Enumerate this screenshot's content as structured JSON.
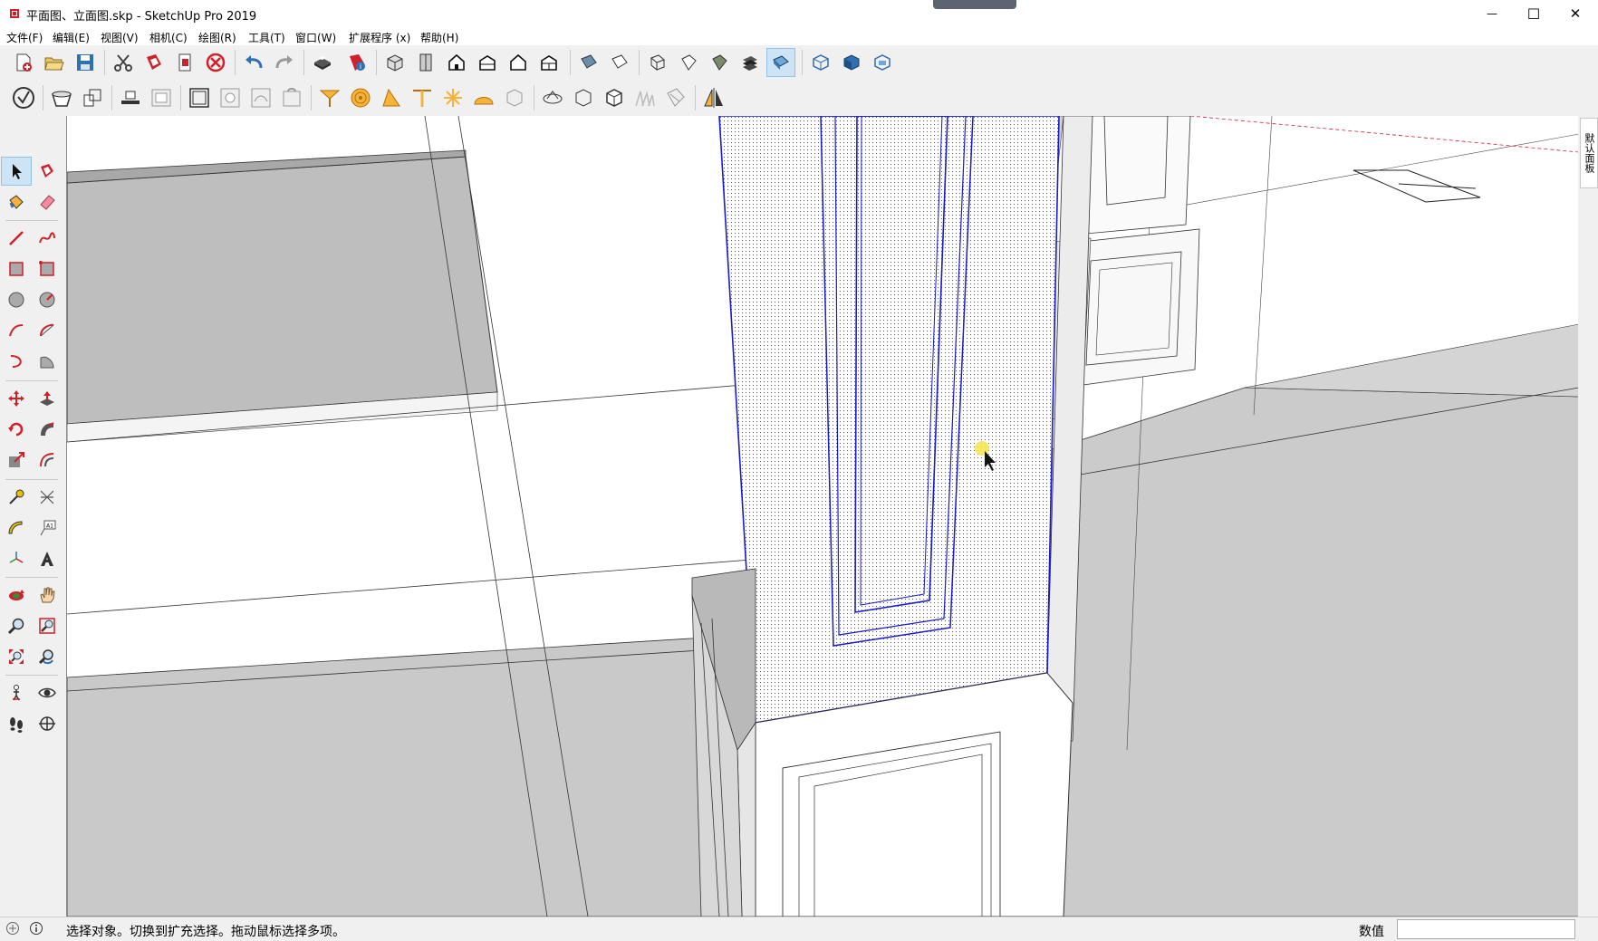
{
  "window": {
    "title": "平面图、立面图.skp - SketchUp Pro 2019",
    "minimize_glyph": "—",
    "maximize_glyph": "☐",
    "close_glyph": "✕"
  },
  "menu": [
    "文件(F)",
    "编辑(E)",
    "视图(V)",
    "相机(C)",
    "绘图(R)",
    "工具(T)",
    "窗口(W)",
    "扩展程序 (x)",
    "帮助(H)"
  ],
  "toolbar1_icons": [
    "new-file-icon",
    "open-folder-icon",
    "save-icon",
    "cut-icon",
    "paste-icon",
    "copy-icon",
    "erase-circle-icon",
    "undo-icon",
    "redo-icon",
    "print-icon",
    "model-info-icon",
    "iso-view-icon",
    "top-view-icon",
    "front-view-icon",
    "right-view-icon",
    "back-view-icon",
    "left-view-icon",
    "xray-icon",
    "back-edges-icon",
    "wireframe-icon",
    "hidden-line-icon",
    "shaded-icon",
    "shaded-textures-icon",
    "monochrome-icon",
    "section-planes-icon",
    "display-sections-icon",
    "section-cuts-icon"
  ],
  "toolbar2_icons": [
    "check-solid-icon",
    "outer-shell-icon",
    "intersect-icon",
    "subtract-icon",
    "union-icon",
    "trim-icon",
    "split-icon",
    "sandbox-from-contours-icon",
    "sandbox-from-scratch-icon",
    "smoove-icon",
    "stamp-icon",
    "drape-icon",
    "add-detail-icon",
    "flip-edge-icon",
    "position-camera-icon",
    "dimension-icon",
    "protractor-icon",
    "axes-icon",
    "add-location-icon",
    "toggle-terrain-icon",
    "photo-texture-icon",
    "get-models-icon",
    "share-model-icon",
    "extension-warehouse-icon",
    "extension-manager-icon",
    "layout-icon",
    "mirror-icon"
  ],
  "left_tools": [
    [
      "select-icon",
      "component-icon"
    ],
    [
      "paint-bucket-icon",
      "eraser-icon"
    ],
    [
      "line-icon",
      "freehand-icon"
    ],
    [
      "rectangle-icon",
      "rotated-rectangle-icon"
    ],
    [
      "circle-icon",
      "polygon-icon"
    ],
    [
      "arc-icon",
      "two-point-arc-icon"
    ],
    [
      "three-point-arc-icon",
      "pie-icon"
    ],
    [
      "move-icon",
      "push-pull-icon"
    ],
    [
      "rotate-icon",
      "follow-me-icon"
    ],
    [
      "scale-icon",
      "offset-icon"
    ],
    [
      "tape-measure-icon",
      "dimension-tool-icon"
    ],
    [
      "protractor-tool-icon",
      "text-icon"
    ],
    [
      "axes-tool-icon",
      "3d-text-icon"
    ],
    [
      "orbit-icon",
      "pan-icon"
    ],
    [
      "zoom-icon",
      "zoom-window-icon"
    ],
    [
      "zoom-extents-icon",
      "previous-view-icon"
    ],
    [
      "position-camera-tool-icon",
      "look-around-icon"
    ],
    [
      "walk-icon",
      "section-plane-icon"
    ]
  ],
  "tray": {
    "tab_label": "默认面板"
  },
  "statusbar": {
    "hint": "选择对象。切换到扩充选择。拖动鼠标选择多项。",
    "measurements_label": "数值",
    "measurements_value": ""
  }
}
